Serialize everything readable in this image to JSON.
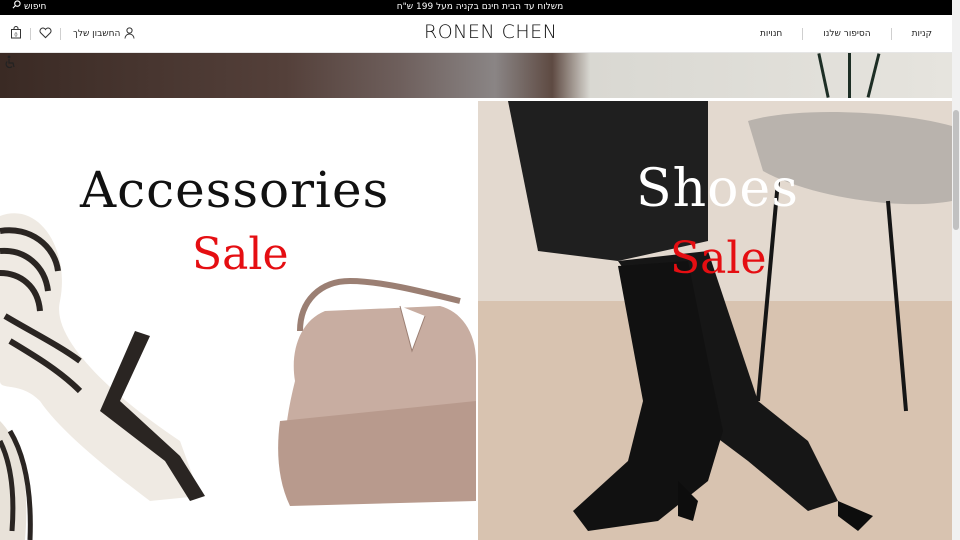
{
  "topbar": {
    "promo_text": "משלוח עד הבית חינם בקניה מעל 199 ש\"ח",
    "search_label": "חיפוש"
  },
  "header": {
    "logo": "RONEN CHEN",
    "nav": [
      "קניות",
      "הסיפור שלנו",
      "חנויות"
    ],
    "account_label": "החשבון שלך"
  },
  "promos": {
    "accessories": {
      "title": "Accessories",
      "sale": "Sale"
    },
    "shoes": {
      "title": "Shoes",
      "sale": "Sale"
    }
  },
  "colors": {
    "sale_red": "#e50e12",
    "topbar_bg": "#000000"
  },
  "icons": [
    "search-icon",
    "cart-bag-icon",
    "heart-icon",
    "user-icon",
    "accessibility-icon"
  ]
}
